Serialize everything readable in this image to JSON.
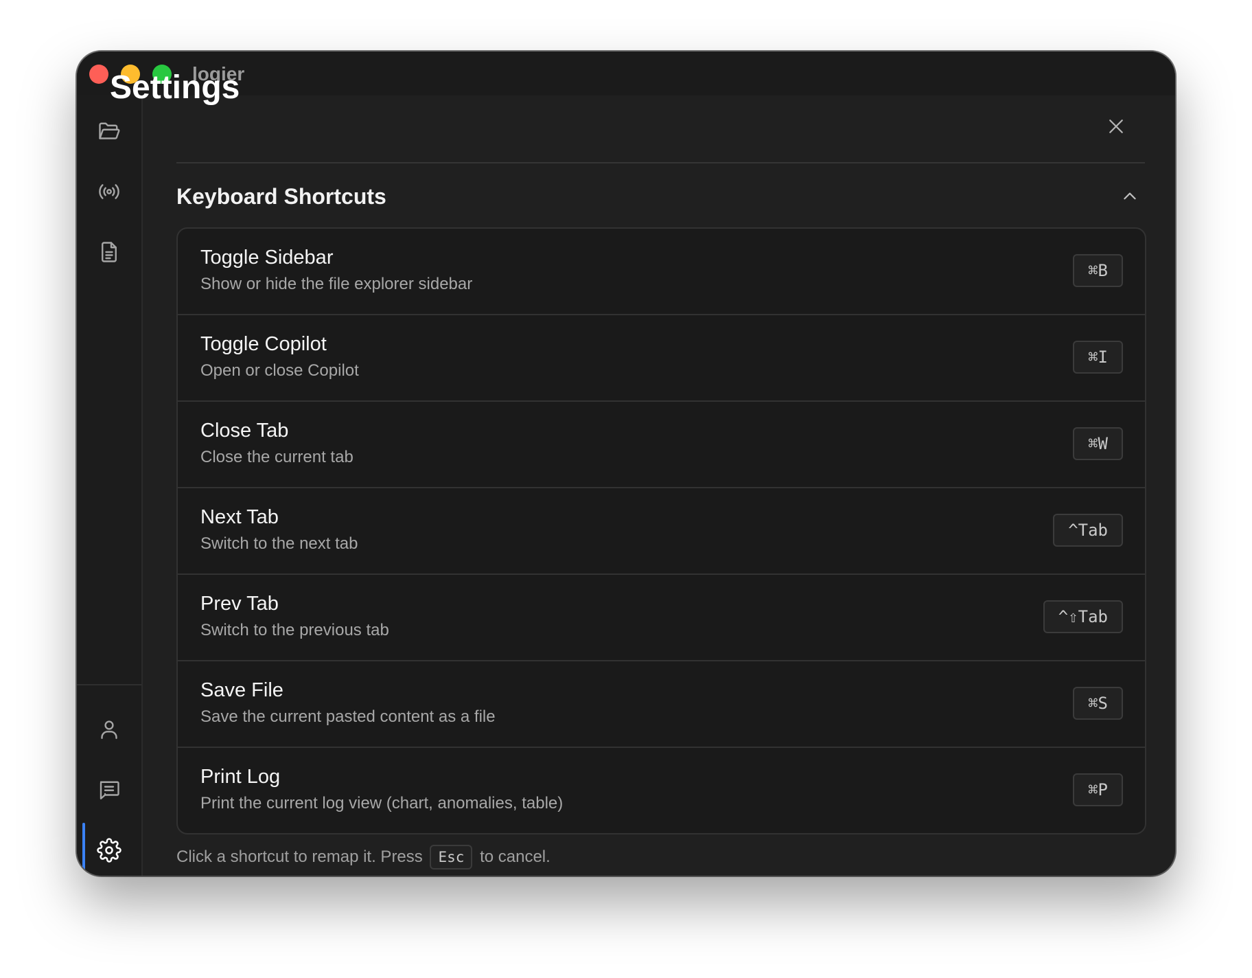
{
  "app": {
    "title": "logier"
  },
  "sidebar": {
    "top_icons": [
      "folder-open-icon",
      "broadcast-icon",
      "document-icon"
    ],
    "bottom_icons": [
      "user-icon",
      "message-icon",
      "gear-icon"
    ],
    "active": "settings",
    "accent": "#3b82f6"
  },
  "settings": {
    "title": "Settings",
    "section_title": "Keyboard Shortcuts",
    "shortcuts": [
      {
        "name": "Toggle Sidebar",
        "desc": "Show or hide the file explorer sidebar",
        "keys": "⌘B"
      },
      {
        "name": "Toggle Copilot",
        "desc": "Open or close Copilot",
        "keys": "⌘I"
      },
      {
        "name": "Close Tab",
        "desc": "Close the current tab",
        "keys": "⌘W"
      },
      {
        "name": "Next Tab",
        "desc": "Switch to the next tab",
        "keys": "^Tab"
      },
      {
        "name": "Prev Tab",
        "desc": "Switch to the previous tab",
        "keys": "^⇧Tab"
      },
      {
        "name": "Save File",
        "desc": "Save the current pasted content as a file",
        "keys": "⌘S"
      },
      {
        "name": "Print Log",
        "desc": "Print the current log view (chart, anomalies, table)",
        "keys": "⌘P"
      }
    ],
    "hint_before": "Click a shortcut to remap it. Press",
    "hint_key": "Esc",
    "hint_after": "to cancel."
  }
}
